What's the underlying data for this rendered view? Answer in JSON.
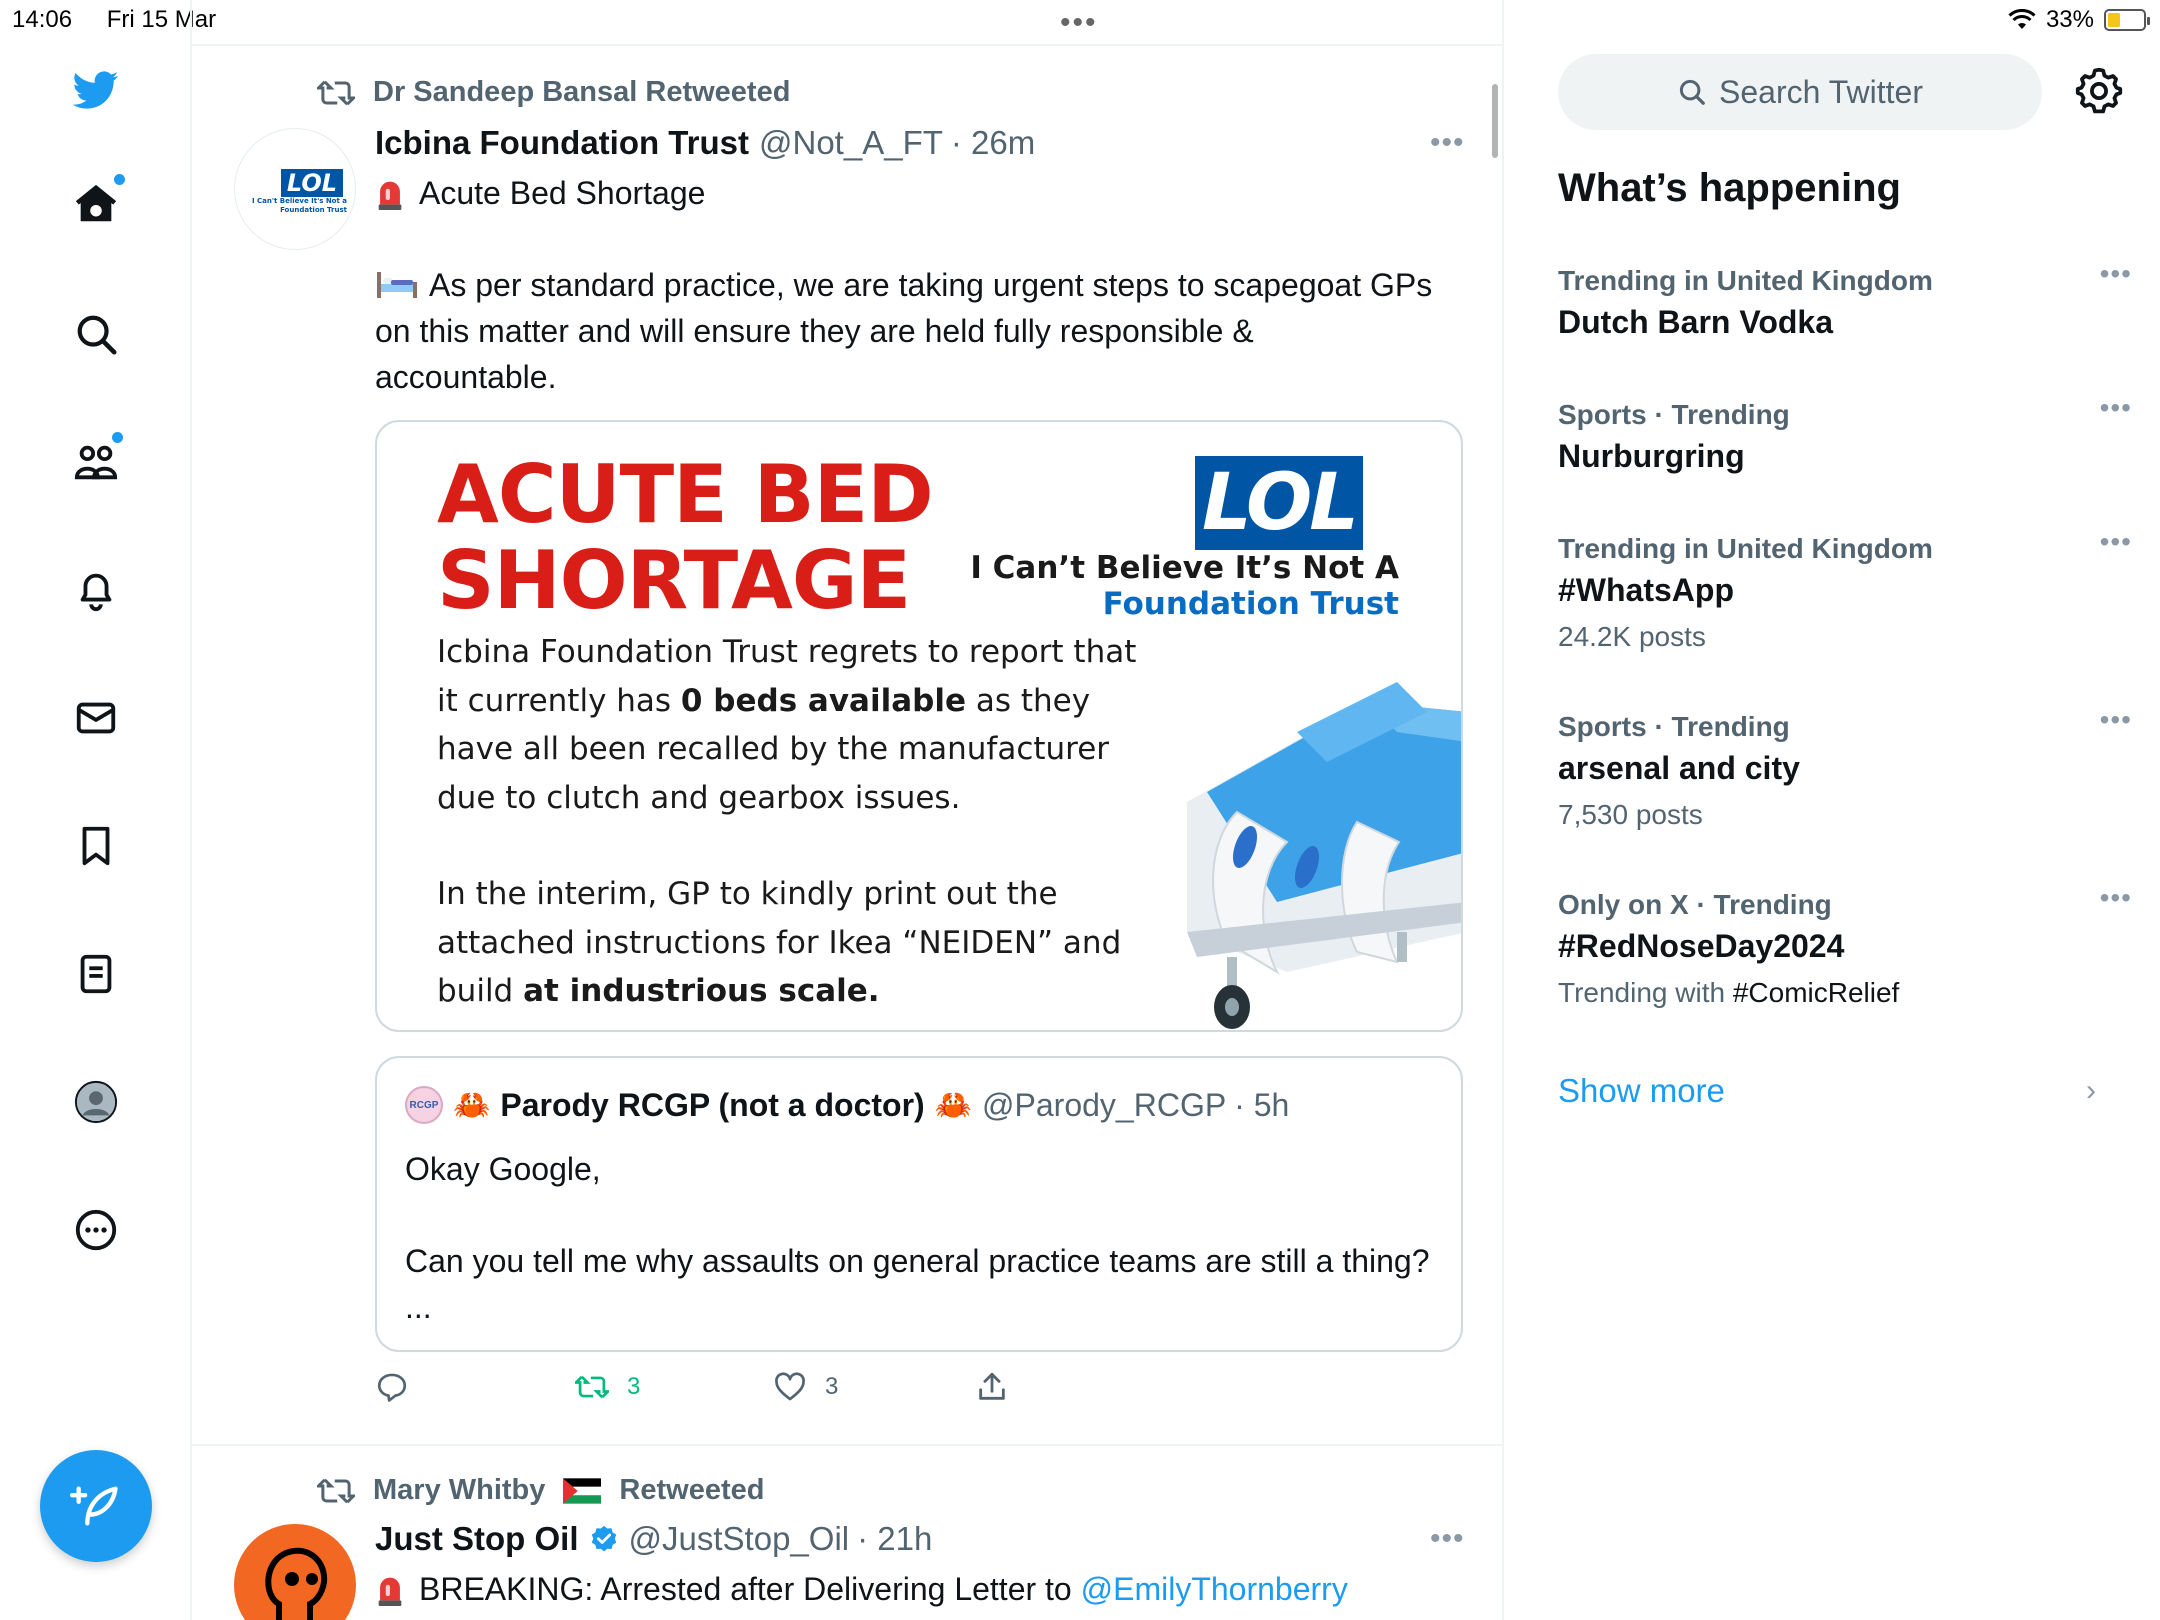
{
  "status_bar": {
    "time": "14:06",
    "date": "Fri 15 Mar",
    "dots": "•••",
    "battery": "33%"
  },
  "nav": {
    "items": [
      "twitter-logo",
      "home",
      "explore",
      "communities",
      "notifications",
      "messages",
      "bookmarks",
      "lists",
      "profile",
      "more"
    ]
  },
  "tweets": [
    {
      "retweeted_by": "Dr Sandeep Bansal Retweeted",
      "name": "Icbina Foundation Trust",
      "handle": "@Not_A_FT",
      "time": "· 26m",
      "avatar_text": "LOL",
      "avatar_sub": "I Can't Believe It's Not a Foundation Trust",
      "text_line1": "Acute Bed Shortage",
      "text_line2": "As per standard practice, we are taking urgent steps to scapegoat GPs on this matter and will ensure they are held fully responsible & accountable.",
      "media": {
        "title_line1": "ACUTE BED",
        "title_line2": "SHORTAGE",
        "logo": "LOL",
        "logo_sub1": "I Can’t Believe It’s Not A",
        "logo_sub2": "Foundation Trust",
        "body_p1_a": "Icbina Foundation Trust regrets to report that it currently has ",
        "body_p1_b": "0 beds available",
        "body_p1_c": " as they have all been recalled by the manufacturer due to clutch and gearbox issues.",
        "body_p2_a": "In the interim, GP to kindly print out the attached instructions for Ikea “NEIDEN” and build ",
        "body_p2_b": "at industrious scale."
      },
      "quote": {
        "avatar_text": "RCGP",
        "name": "Parody RCGP (not a doctor)",
        "handle": "@Parody_RCGP",
        "time": "· 5h",
        "text_line1": "Okay Google,",
        "text_line2": "Can you tell me why assaults on general practice teams are still a thing? ..."
      },
      "actions": {
        "replies": "",
        "retweets": "3",
        "likes": "3"
      }
    },
    {
      "retweeted_by_name": "Mary Whitby",
      "retweeted_by_suffix": "Retweeted",
      "name": "Just Stop Oil",
      "handle": "@JustStop_Oil",
      "time": "· 21h",
      "text_prefix": "BREAKING: Arrested after Delivering Letter to ",
      "text_mention": "@EmilyThornberry"
    }
  ],
  "sidebar": {
    "search_placeholder": "Search Twitter",
    "title": "What’s happening",
    "trends": [
      {
        "context": "Trending in United Kingdom",
        "topic": "Dutch Barn Vodka",
        "meta": ""
      },
      {
        "context": "Sports · Trending",
        "topic": "Nurburgring",
        "meta": ""
      },
      {
        "context": "Trending in United Kingdom",
        "topic": "#WhatsApp",
        "meta": "24.2K posts"
      },
      {
        "context": "Sports · Trending",
        "topic": "arsenal and city",
        "meta": "7,530 posts"
      },
      {
        "context": "Only on X · Trending",
        "topic": "#RedNoseDay2024",
        "meta_prefix": "Trending with ",
        "meta_tag": "#ComicRelief"
      }
    ],
    "show_more": "Show more"
  },
  "colors": {
    "accent": "#1d9bf0",
    "retweet_green": "#00ba7c",
    "media_red": "#d91e18",
    "lol_blue": "#0055a5"
  }
}
